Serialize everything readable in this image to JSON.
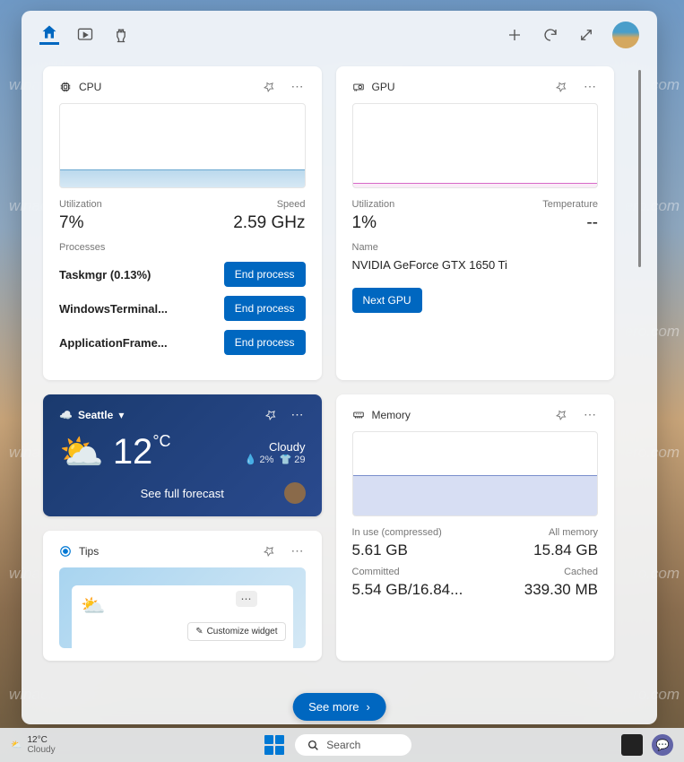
{
  "watermark": "winaero.com",
  "header": {
    "add_label": "Add widget",
    "refresh_label": "Refresh",
    "expand_label": "Expand"
  },
  "cpu": {
    "title": "CPU",
    "util_label": "Utilization",
    "util_val": "7%",
    "speed_label": "Speed",
    "speed_val": "2.59 GHz",
    "proc_label": "Processes",
    "end_label": "End process",
    "processes": [
      {
        "name": "Taskmgr (0.13%)"
      },
      {
        "name": "WindowsTerminal..."
      },
      {
        "name": "ApplicationFrame..."
      }
    ]
  },
  "gpu": {
    "title": "GPU",
    "util_label": "Utilization",
    "util_val": "1%",
    "temp_label": "Temperature",
    "temp_val": "--",
    "name_label": "Name",
    "name_val": "NVIDIA GeForce GTX 1650 Ti",
    "next_label": "Next GPU"
  },
  "weather": {
    "city": "Seattle",
    "temp": "12",
    "unit": "°C",
    "condition": "Cloudy",
    "humidity": "2%",
    "feels": "29",
    "forecast_link": "See full forecast"
  },
  "memory": {
    "title": "Memory",
    "inuse_label": "In use (compressed)",
    "inuse_val": "5.61 GB",
    "all_label": "All memory",
    "all_val": "15.84 GB",
    "committed_label": "Committed",
    "committed_val": "5.54 GB/16.84...",
    "cached_label": "Cached",
    "cached_val": "339.30 MB"
  },
  "tips": {
    "title": "Tips",
    "customize": "Customize widget"
  },
  "see_more": "See more",
  "taskbar": {
    "temp": "12°C",
    "cond": "Cloudy",
    "search": "Search"
  },
  "chart_data": [
    {
      "type": "area",
      "title": "CPU Utilization",
      "ylim": [
        0,
        100
      ],
      "values": [
        8,
        9,
        7,
        10,
        12,
        8,
        7,
        9,
        7,
        6,
        8,
        7
      ],
      "color": "#6aa8d0"
    },
    {
      "type": "area",
      "title": "GPU Utilization",
      "ylim": [
        0,
        100
      ],
      "values": [
        1,
        1,
        2,
        1,
        1,
        1,
        1,
        2,
        1,
        1,
        1,
        1
      ],
      "color": "#d668c8"
    },
    {
      "type": "area",
      "title": "Memory In Use",
      "ylim": [
        0,
        100
      ],
      "values": [
        35,
        35,
        36,
        35,
        35,
        36,
        35,
        35,
        35,
        36,
        35,
        35
      ],
      "color": "#7a8ecc"
    }
  ]
}
